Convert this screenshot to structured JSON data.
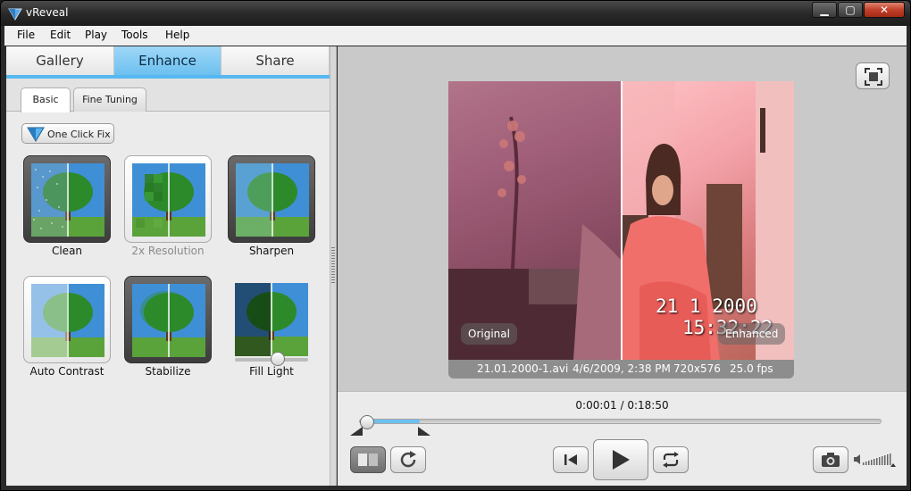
{
  "window": {
    "title": "vReveal"
  },
  "menu": [
    "File",
    "Edit",
    "Play",
    "Tools",
    "Help"
  ],
  "tabs": [
    "Gallery",
    "Enhance",
    "Share"
  ],
  "active_tab": "Enhance",
  "subtabs": [
    "Basic",
    "Fine Tuning"
  ],
  "active_subtab": "Basic",
  "one_click_fix": "One Click Fix",
  "effects": [
    {
      "label": "Clean",
      "state": "on"
    },
    {
      "label": "2x Resolution",
      "state": "disabled"
    },
    {
      "label": "Sharpen",
      "state": "on"
    },
    {
      "label": "Auto Contrast",
      "state": "off"
    },
    {
      "label": "Stabilize",
      "state": "on"
    },
    {
      "label": "Fill Light",
      "state": "slider",
      "level": 0.6
    }
  ],
  "video": {
    "original_label": "Original",
    "enhanced_label": "Enhanced",
    "osd_date": "21  1 2000",
    "osd_time": "15:32:22"
  },
  "info": {
    "filename": "21.01.2000-1.avi",
    "date": "4/6/2009, 2:38 PM",
    "resolution": "720x576",
    "fps": "25.0 fps"
  },
  "playback": {
    "timecode": "0:00:01 / 0:18:50",
    "position_fraction": 0.001,
    "buffered_fraction": 0.11
  },
  "colors": {
    "accent": "#6cc0ef",
    "title_bar": "#2a2a2a",
    "panel": "#ebebeb",
    "viewer": "#c9c9c9"
  }
}
